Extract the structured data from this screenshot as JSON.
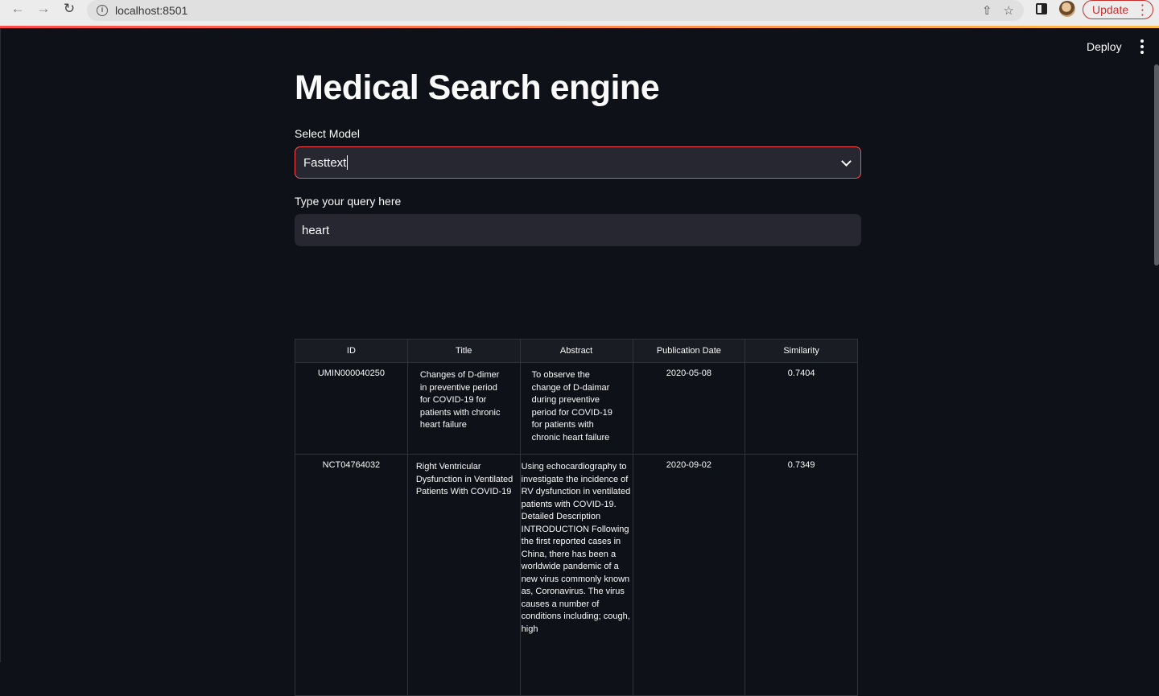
{
  "browser": {
    "url": "localhost:8501",
    "update_label": "Update"
  },
  "app": {
    "deploy_label": "Deploy",
    "title": "Medical Search engine",
    "model_select": {
      "label": "Select Model",
      "value": "Fasttext"
    },
    "query": {
      "label": "Type your query here",
      "value": "heart"
    }
  },
  "results": {
    "columns": [
      "ID",
      "Title",
      "Abstract",
      "Publication Date",
      "Similarity"
    ],
    "rows": [
      {
        "id": "UMIN000040250",
        "title": "Changes of D-dimer in preventive period for COVID-19 for patients with chronic heart failure",
        "abstract": "To observe the change of D-daimar during preventive period for COVID-19 for patients with chronic heart failure",
        "date": "2020-05-08",
        "similarity": "0.7404"
      },
      {
        "id": "NCT04764032",
        "title": "Right Ventricular Dysfunction in Ventilated Patients With COVID-19",
        "abstract": "Using echocardiography to investigate the incidence of RV dysfunction in ventilated patients with COVID-19.  Detailed Description INTRODUCTION Following the first reported cases in China, there has been a worldwide pandemic of a new virus commonly known as, Coronavirus. The virus causes a number of conditions including; cough, high",
        "date": "2020-09-02",
        "similarity": "0.7349"
      }
    ]
  }
}
